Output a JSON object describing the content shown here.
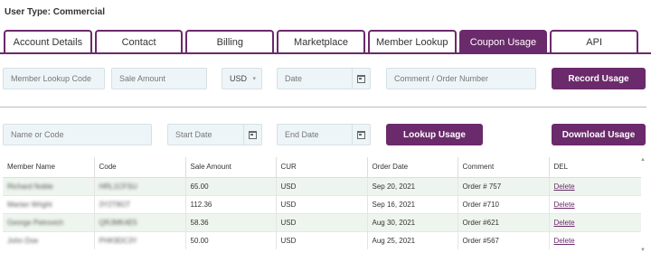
{
  "user_type": "User Type: Commercial",
  "tabs": [
    {
      "label": "Account Details"
    },
    {
      "label": "Contact"
    },
    {
      "label": "Billing"
    },
    {
      "label": "Marketplace"
    },
    {
      "label": "Member Lookup"
    },
    {
      "label": "Coupon Usage",
      "active": true
    },
    {
      "label": "API"
    }
  ],
  "record_form": {
    "member_lookup_code_placeholder": "Member Lookup Code",
    "sale_amount_placeholder": "Sale Amount",
    "currency_value": "USD",
    "date_placeholder": "Date",
    "comment_placeholder": "Comment / Order Number",
    "record_button": "Record Usage"
  },
  "lookup_form": {
    "name_placeholder": "Name or Code",
    "start_date_placeholder": "Start Date",
    "end_date_placeholder": "End Date",
    "lookup_button": "Lookup Usage",
    "download_button": "Download Usage"
  },
  "table": {
    "headers": [
      "Member Name",
      "Code",
      "Sale Amount",
      "CUR",
      "Order Date",
      "Comment",
      "DEL"
    ],
    "rows": [
      {
        "name": "Richard Noble",
        "code": "HRL1CFSU",
        "amount": "65.00",
        "cur": "USD",
        "date": "Sep 20, 2021",
        "comment": "Order # 757",
        "del": "Delete"
      },
      {
        "name": "Marian Wright",
        "code": "3Y2T8GT",
        "amount": "112.36",
        "cur": "USD",
        "date": "Sep 16, 2021",
        "comment": "Order #710",
        "del": "Delete"
      },
      {
        "name": "George Petrovich",
        "code": "QRJMK4E5",
        "amount": "58.36",
        "cur": "USD",
        "date": "Aug 30, 2021",
        "comment": "Order #621",
        "del": "Delete"
      },
      {
        "name": "John Doe",
        "code": "PHK9DC3Y",
        "amount": "50.00",
        "cur": "USD",
        "date": "Aug 25, 2021",
        "comment": "Order #567",
        "del": "Delete"
      }
    ]
  },
  "colors": {
    "accent": "#6b2a6b",
    "field_bg": "#eef5f8",
    "row_alt": "#eef5ee"
  }
}
